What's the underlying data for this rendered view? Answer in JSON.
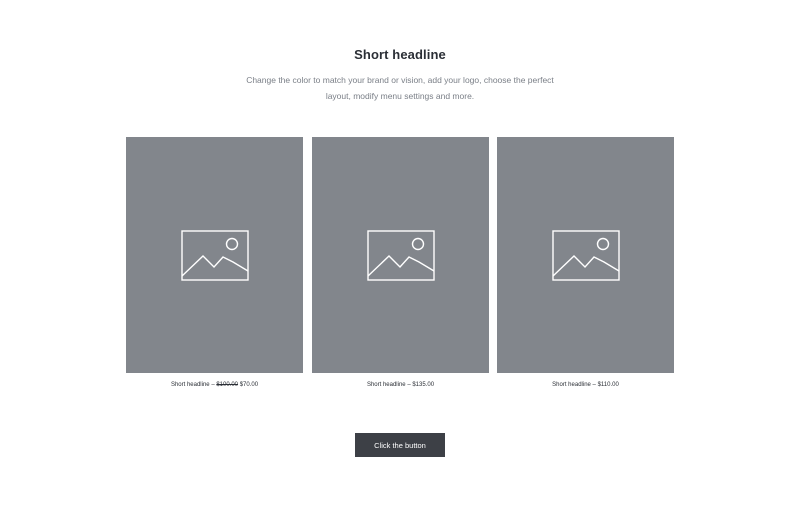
{
  "section": {
    "headline": "Short headline",
    "subtext": "Change the color to match your brand or vision, add your logo, choose the perfect layout, modify menu settings and more."
  },
  "products": [
    {
      "name": "Short headline",
      "separator": "–",
      "original_price": "$100.00",
      "price": "$70.00",
      "image_icon": "image-placeholder-icon"
    },
    {
      "name": "Short headline",
      "separator": "–",
      "original_price": "",
      "price": "$135.00",
      "image_icon": "image-placeholder-icon"
    },
    {
      "name": "Short headline",
      "separator": "–",
      "original_price": "",
      "price": "$110.00",
      "image_icon": "image-placeholder-icon"
    }
  ],
  "button": {
    "label": "Click the button"
  },
  "colors": {
    "placeholder_bg": "#82868c",
    "button_bg": "#3d4046",
    "headline": "#2b2f36",
    "subtext": "#7a7f87"
  }
}
